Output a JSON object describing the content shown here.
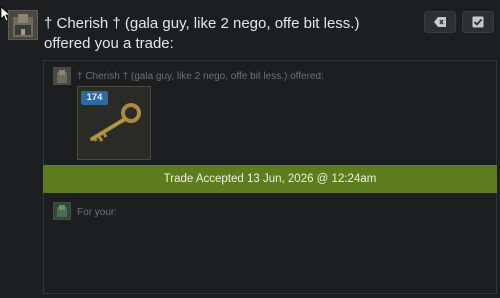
{
  "trade": {
    "title": "† Cherish † (gala guy, like 2 nego, offe bit less.) offered you a trade:",
    "offered_label": "† Cherish † (gala guy, like 2 nego, offe bit less.) offered:",
    "item": {
      "count": "174",
      "icon": "key-icon"
    },
    "status": "Trade Accepted 13 Jun, 2026 @ 12:24am",
    "for_your_label": "For your:"
  },
  "actions": {
    "dismiss_icon": "tag-dismiss-icon",
    "accept_icon": "checkmark-icon"
  },
  "colors": {
    "background": "#1d1e20",
    "accepted_bar": "#5c7c1e",
    "badge": "#2d6aa3",
    "title_text": "#e6e6e6",
    "muted_text": "#707070"
  }
}
